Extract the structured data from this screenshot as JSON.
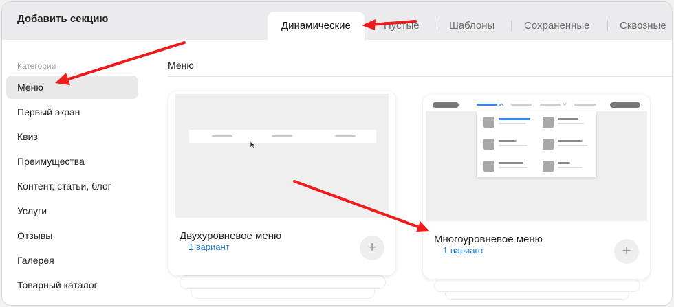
{
  "panel": {
    "title": "Добавить секцию"
  },
  "tabs": [
    {
      "label": "Динамические",
      "active": true
    },
    {
      "label": "Пустые"
    },
    {
      "label": "Шаблоны"
    },
    {
      "label": "Сохраненные"
    },
    {
      "label": "Сквозные"
    }
  ],
  "sidebar": {
    "heading": "Категории",
    "items": [
      {
        "label": "Меню",
        "active": true
      },
      {
        "label": "Первый экран"
      },
      {
        "label": "Квиз"
      },
      {
        "label": "Преимущества"
      },
      {
        "label": "Контент, статьи, блог"
      },
      {
        "label": "Услуги"
      },
      {
        "label": "Отзывы"
      },
      {
        "label": "Галерея"
      },
      {
        "label": "Товарный каталог"
      }
    ]
  },
  "main": {
    "heading": "Меню",
    "cards": [
      {
        "title": "Двухуровневое меню",
        "variants": "1 вариант",
        "plus": "+"
      },
      {
        "title": "Многоуровневое меню",
        "variants": "1 вариант",
        "plus": "+"
      }
    ]
  },
  "colors": {
    "accent_link": "#1d7ad6",
    "annotation_arrow": "#ee1c1c",
    "active_tab_bg": "#ffffff"
  }
}
